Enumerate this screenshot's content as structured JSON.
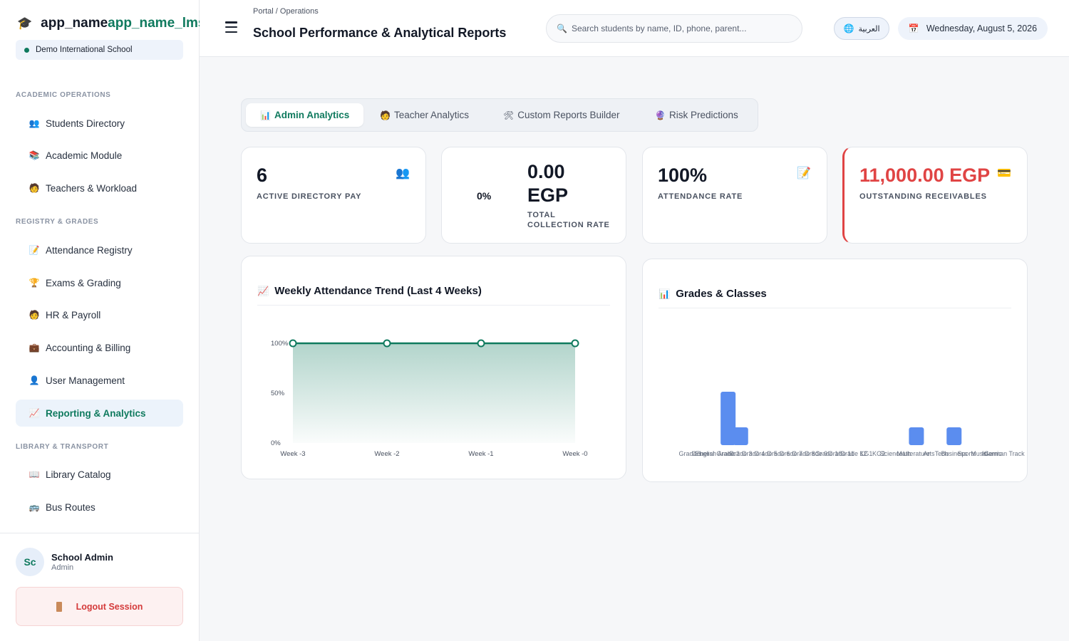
{
  "brand": {
    "icon": "graduation-cap-icon",
    "name_a": "app_name",
    "name_b": "app_name_lms"
  },
  "school": {
    "name": "Demo International School"
  },
  "sidebar": {
    "sections": [
      {
        "title": "ACADEMIC OPERATIONS"
      },
      {
        "title": "REGISTRY & GRADES"
      },
      {
        "title": "LIBRARY & TRANSPORT"
      }
    ],
    "items": [
      {
        "label": "Students Directory",
        "icon": "users-icon"
      },
      {
        "label": "Academic Module",
        "icon": "books-icon"
      },
      {
        "label": "Teachers & Workload",
        "icon": "teacher-icon"
      },
      {
        "label": "Attendance Registry",
        "icon": "memo-icon"
      },
      {
        "label": "Exams & Grading",
        "icon": "trophy-icon"
      },
      {
        "label": "HR & Payroll",
        "icon": "person-icon"
      },
      {
        "label": "Accounting & Billing",
        "icon": "briefcase-icon"
      },
      {
        "label": "User Management",
        "icon": "user-icon"
      },
      {
        "label": "Reporting & Analytics",
        "icon": "chart-icon"
      },
      {
        "label": "Library Catalog",
        "icon": "book-icon"
      },
      {
        "label": "Bus Routes",
        "icon": "bus-icon"
      }
    ],
    "active_index": 8
  },
  "user": {
    "initials": "Sc",
    "name": "School Admin",
    "role": "Admin"
  },
  "logout": {
    "label": "Logout Session"
  },
  "header": {
    "breadcrumb": "Portal / Operations",
    "title": "School Performance & Analytical Reports",
    "search_placeholder": "Search students by name, ID, phone, parent...",
    "language": "العربية",
    "date": "Wednesday, August 5, 2026"
  },
  "tabs": [
    {
      "label": "Admin Analytics",
      "icon": "bar-chart-icon"
    },
    {
      "label": "Teacher Analytics",
      "icon": "teacher-icon"
    },
    {
      "label": "Custom Reports Builder",
      "icon": "tools-icon"
    },
    {
      "label": "Risk Predictions",
      "icon": "crystal-ball-icon"
    }
  ],
  "kpis": {
    "active_directory": {
      "value": "6",
      "label": "ACTIVE DIRECTORY PAY",
      "icon": "users-icon"
    },
    "collection": {
      "percent": "0%",
      "value_line1": "0.00",
      "value_line2": "EGP",
      "label_line1": "TOTAL",
      "label_line2": "COLLECTION RATE"
    },
    "attendance": {
      "value": "100%",
      "label": "ATTENDANCE RATE",
      "icon": "memo-icon"
    },
    "receivables": {
      "value": "11,000.00 EGP",
      "label": "OUTSTANDING RECEIVABLES",
      "icon": "credit-card-icon"
    }
  },
  "colors": {
    "accent": "#0f7a5e",
    "danger": "#e04444",
    "bar": "#5b8def"
  },
  "chart_data": [
    {
      "type": "area",
      "title": "Weekly Attendance Trend (Last 4 Weeks)",
      "icon": "line-chart-icon",
      "categories": [
        "Week -3",
        "Week -2",
        "Week -1",
        "Week -0"
      ],
      "values": [
        100,
        100,
        100,
        100
      ],
      "ylim": [
        0,
        100
      ],
      "yticks": [
        "0%",
        "50%",
        "100%"
      ]
    },
    {
      "type": "bar",
      "title": "Grades & Classes",
      "icon": "bar-chart-icon",
      "categories": [
        "Grade 1",
        "General",
        "English Arabic",
        "Grade 2",
        "Grade 3",
        "Grade 4",
        "Grade 5",
        "Grade 6",
        "Grade 7",
        "Grade 8",
        "Grade 9",
        "Grade 10",
        "Grade 11",
        "Grade 12",
        "KG1",
        "KG2",
        "Science",
        "Math",
        "Literature",
        "Arts",
        "Tech",
        "Business",
        "Sports",
        "Music",
        "Islamic",
        "German Track"
      ],
      "values": [
        0,
        0,
        0,
        3,
        1,
        0,
        0,
        0,
        0,
        0,
        0,
        0,
        0,
        0,
        0,
        0,
        0,
        0,
        1,
        0,
        0,
        1,
        0,
        0,
        0,
        0
      ],
      "ylim": [
        0,
        4
      ]
    }
  ]
}
